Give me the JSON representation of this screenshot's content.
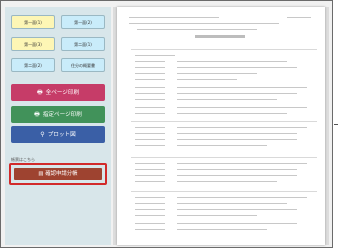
{
  "sidebar": {
    "tabs": [
      {
        "label": "第一面(1)",
        "color": "#fdf6b5"
      },
      {
        "label": "第一面(2)",
        "color": "#c9ecfa"
      },
      {
        "label": "第一面(3)",
        "color": "#fdf6b5"
      },
      {
        "label": "第二面(1)",
        "color": "#c9ecfa"
      },
      {
        "label": "第二面(2)",
        "color": "#c9ecfa"
      },
      {
        "label": "住分の概要書",
        "color": "#c9ecfa"
      }
    ],
    "buttons": {
      "print_all": "全ページ印刷",
      "print_selected": "指定ページ印刷",
      "plot": "プロット図",
      "notice": "帳票はこちら",
      "confirm_report": "確認申請分帳"
    },
    "icons": {
      "print_all": "printer-icon",
      "print_selected": "printer-icon",
      "plot": "location-pin-icon",
      "confirm_report": "document-icon"
    }
  },
  "document": {
    "header_left": "",
    "header_right": ""
  },
  "colors": {
    "print_all_btn": "#c63c68",
    "print_selected_btn": "#41925a",
    "plot_btn": "#3a5fa6",
    "confirm_btn": "#9e4330",
    "highlight_outline": "#d22a2a"
  }
}
